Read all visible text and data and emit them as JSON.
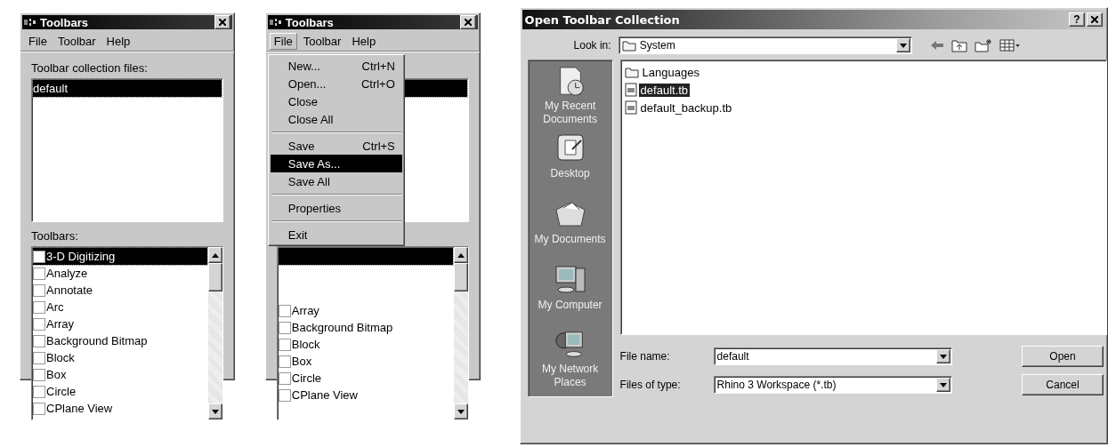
{
  "toolbar_windows": [
    {
      "title": "Toolbars",
      "menu_open": false,
      "menus": [
        {
          "label": "File",
          "selected": false
        },
        {
          "label": "Toolbar",
          "selected": false
        },
        {
          "label": "Help",
          "selected": false
        }
      ],
      "collection_label": "Toolbar collection files:",
      "collection_files": [
        {
          "label": "default",
          "selected": true
        }
      ],
      "toolbars_label": "Toolbars:",
      "toolbars": [
        {
          "label": "3-D Digitizing",
          "checked": false,
          "selected": true
        },
        {
          "label": "Analyze",
          "checked": false,
          "selected": false
        },
        {
          "label": "Annotate",
          "checked": false,
          "selected": false
        },
        {
          "label": "Arc",
          "checked": false,
          "selected": false
        },
        {
          "label": "Array",
          "checked": false,
          "selected": false
        },
        {
          "label": "Background Bitmap",
          "checked": false,
          "selected": false
        },
        {
          "label": "Block",
          "checked": false,
          "selected": false
        },
        {
          "label": "Box",
          "checked": false,
          "selected": false
        },
        {
          "label": "Circle",
          "checked": false,
          "selected": false
        },
        {
          "label": "CPlane View",
          "checked": false,
          "selected": false
        }
      ]
    },
    {
      "title": "Toolbars",
      "menu_open": true,
      "menus": [
        {
          "label": "File",
          "selected": true
        },
        {
          "label": "Toolbar",
          "selected": false
        },
        {
          "label": "Help",
          "selected": false
        }
      ],
      "collection_files": [
        {
          "selected": true
        }
      ],
      "toolbars": [
        {
          "selected": true
        },
        {
          "label": "Array",
          "checked": false,
          "selected": false
        },
        {
          "label": "Background Bitmap",
          "checked": false,
          "selected": false
        },
        {
          "label": "Block",
          "checked": false,
          "selected": false
        },
        {
          "label": "Box",
          "checked": false,
          "selected": false
        },
        {
          "label": "Circle",
          "checked": false,
          "selected": false
        },
        {
          "label": "CPlane View",
          "checked": false,
          "selected": false
        }
      ],
      "file_menu": [
        {
          "kind": "item",
          "label": "New...",
          "shortcut": "Ctrl+N",
          "selected": false
        },
        {
          "kind": "item",
          "label": "Open...",
          "shortcut": "Ctrl+O",
          "selected": false
        },
        {
          "kind": "item",
          "label": "Close",
          "selected": false
        },
        {
          "kind": "item",
          "label": "Close All",
          "selected": false
        },
        {
          "kind": "separator"
        },
        {
          "kind": "item",
          "label": "Save",
          "shortcut": "Ctrl+S",
          "selected": false
        },
        {
          "kind": "item",
          "label": "Save As...",
          "selected": true
        },
        {
          "kind": "item",
          "label": "Save All",
          "selected": false
        },
        {
          "kind": "separator"
        },
        {
          "kind": "item",
          "label": "Properties",
          "selected": false
        },
        {
          "kind": "separator"
        },
        {
          "kind": "item",
          "label": "Exit",
          "selected": false
        }
      ]
    }
  ],
  "dialog": {
    "title": "Open Toolbar Collection",
    "help_button": "?",
    "look_in_label": "Look in:",
    "look_in": "System",
    "places": [
      {
        "kind": "recent",
        "label": "My Recent Documents"
      },
      {
        "kind": "desktop",
        "label": "Desktop"
      },
      {
        "kind": "documents",
        "label": "My Documents"
      },
      {
        "kind": "computer",
        "label": "My Computer"
      },
      {
        "kind": "network",
        "label": "My Network Places"
      }
    ],
    "files": [
      {
        "kind": "folder",
        "label": "Languages",
        "selected": false
      },
      {
        "kind": "file",
        "label": "default.tb",
        "selected": true
      },
      {
        "kind": "file",
        "label": "default_backup.tb",
        "selected": false
      }
    ],
    "file_name_label": "File name:",
    "file_name": "default",
    "file_type_label": "Files of type:",
    "file_type": "Rhino 3 Workspace (*.tb)",
    "buttons": [
      "Open",
      "Cancel"
    ]
  }
}
